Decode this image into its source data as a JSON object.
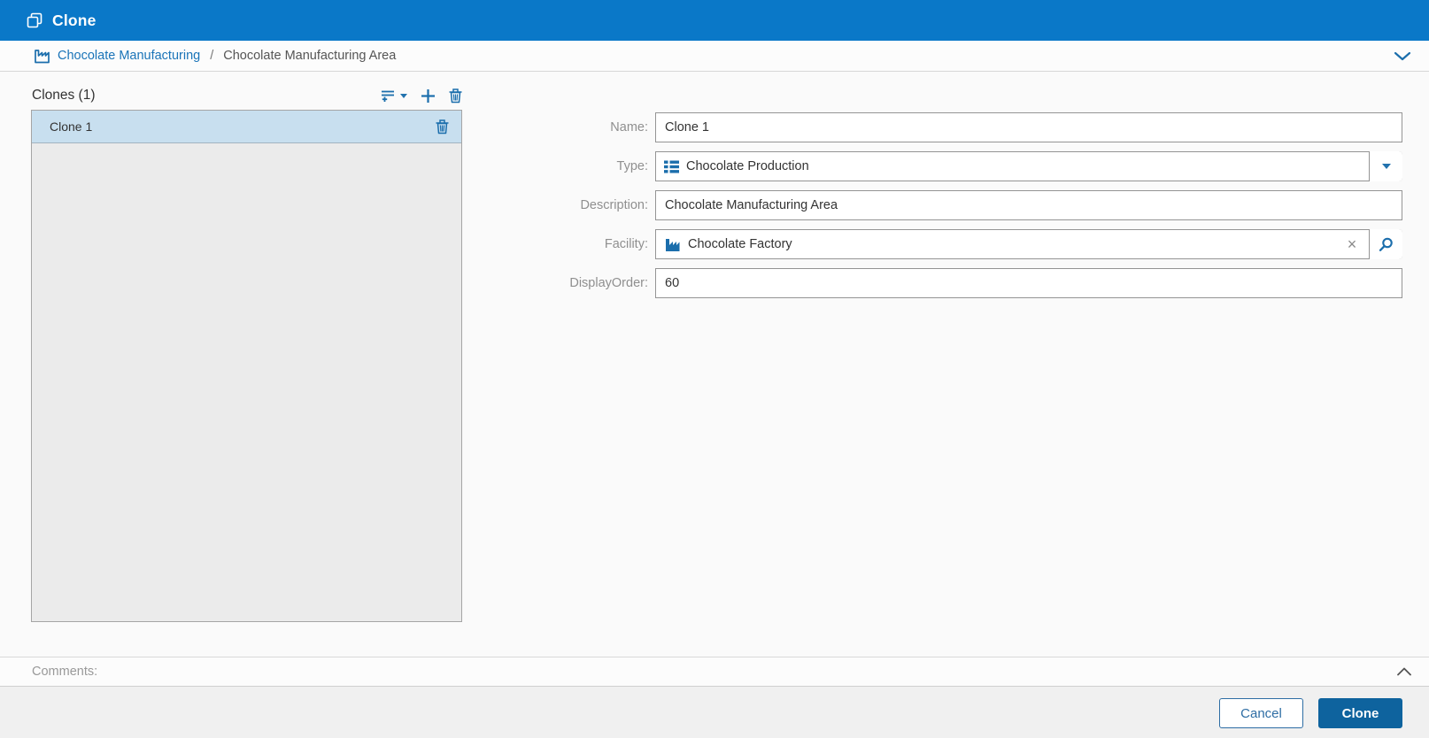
{
  "header": {
    "title": "Clone",
    "icon": "clone-icon"
  },
  "breadcrumb": {
    "icon": "factory-outline-icon",
    "link_label": "Chocolate Manufacturing",
    "separator": "/",
    "current_label": "Chocolate Manufacturing Area",
    "collapse_icon": "chevron-down-icon"
  },
  "clones_panel": {
    "title": "Clones (1)",
    "toolbar": {
      "sort_icon": "sort-add-icon",
      "sort_caret_icon": "caret-down-icon",
      "add_icon": "plus-icon",
      "delete_icon": "trash-icon"
    },
    "items": [
      {
        "name": "Clone 1",
        "selected": true,
        "delete_icon": "trash-icon"
      }
    ]
  },
  "form": {
    "fields": [
      {
        "label": "Name:",
        "value": "Clone 1",
        "type": "text"
      },
      {
        "label": "Type:",
        "value": "Chocolate Production",
        "type": "combo",
        "icon": "list-type-icon",
        "button_icon": "caret-down-icon"
      },
      {
        "label": "Description:",
        "value": "Chocolate Manufacturing Area",
        "type": "text"
      },
      {
        "label": "Facility:",
        "value": "Chocolate Factory",
        "type": "lookup",
        "icon": "factory-solid-icon",
        "clear_icon": "x-clear-icon",
        "button_icon": "search-icon"
      },
      {
        "label": "DisplayOrder:",
        "value": "60",
        "type": "text"
      }
    ]
  },
  "comments": {
    "label": "Comments:",
    "collapse_icon": "chevron-up-icon"
  },
  "footer": {
    "cancel_label": "Cancel",
    "clone_label": "Clone"
  },
  "colors": {
    "titlebar_blue": "#0a78c8",
    "accent_blue": "#1b6eac",
    "link_blue": "#1a74b8",
    "primary_button_blue": "#0e639e",
    "selected_row_blue": "#c8dfef",
    "panel_gray": "#ebebeb",
    "footer_gray": "#f0f0f0",
    "label_gray": "#8f8f8f"
  }
}
